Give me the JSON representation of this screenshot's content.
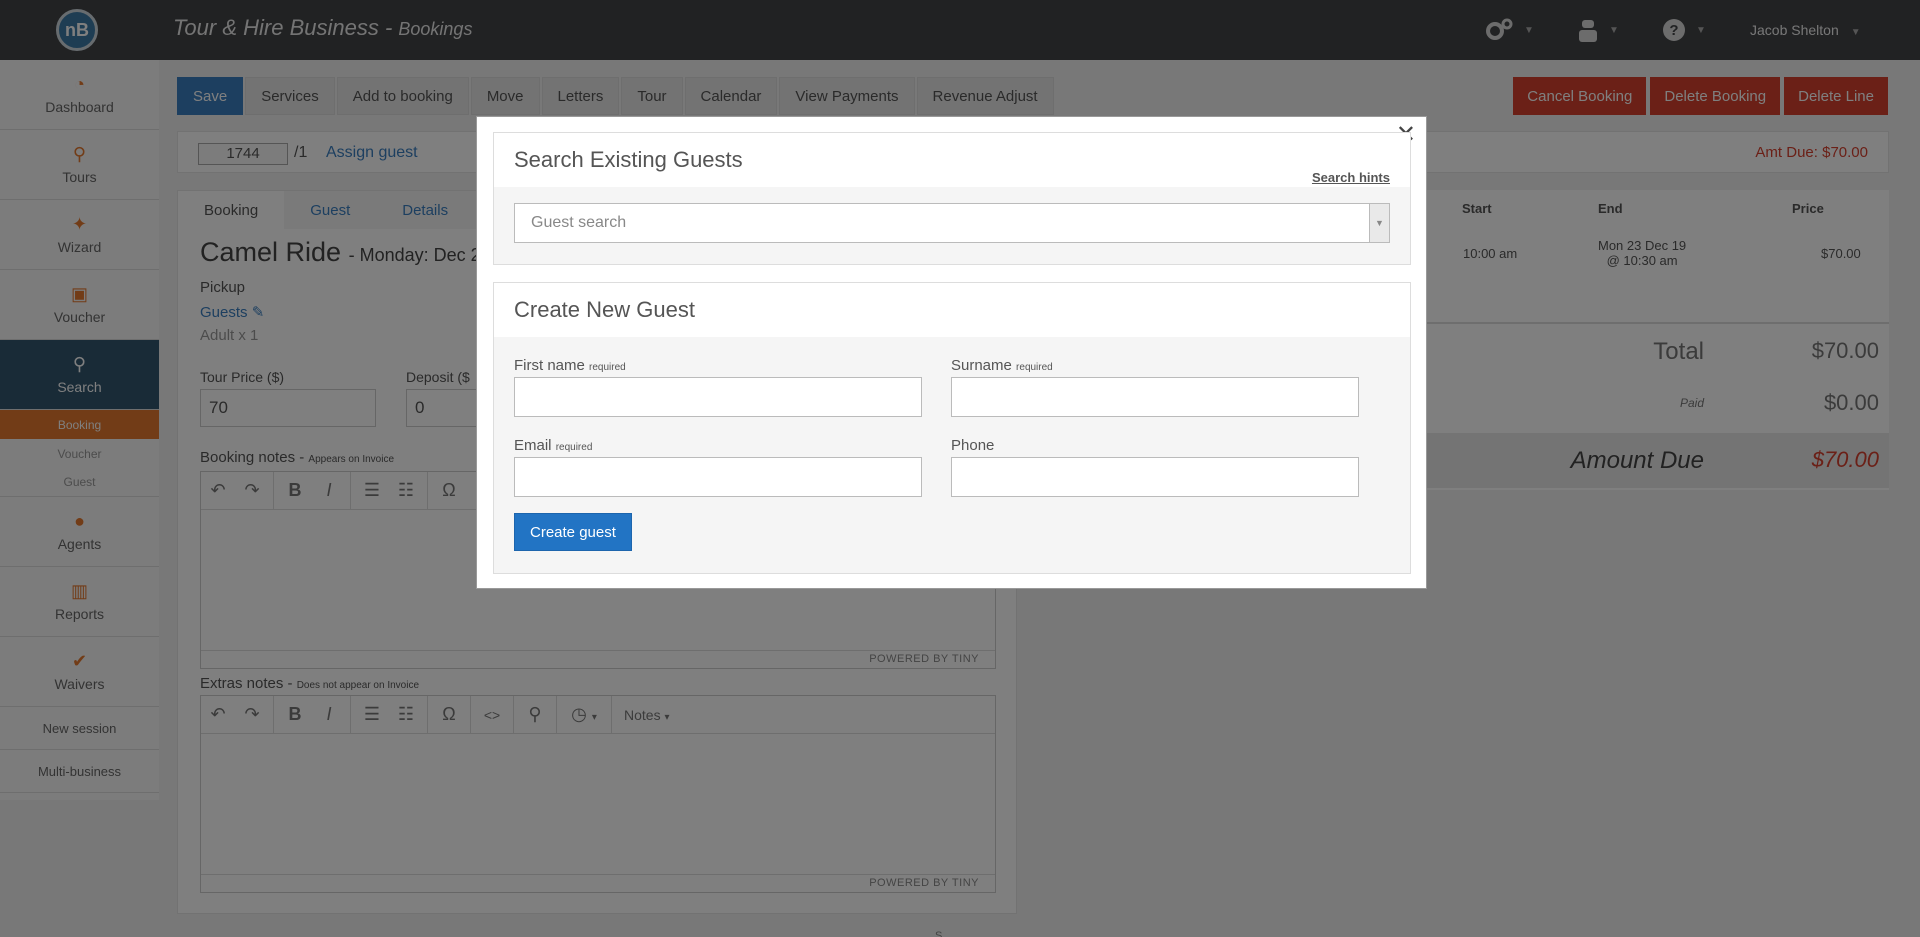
{
  "header": {
    "logo_text": "nB",
    "app_title": "Tour & Hire Business - ",
    "app_section": "Bookings",
    "user_name": "Jacob Shelton",
    "icons": [
      "gears-icon",
      "agent-icon",
      "help-icon"
    ]
  },
  "sidebar": {
    "items": [
      {
        "label": "Dashboard",
        "icon": "dashboard-icon"
      },
      {
        "label": "Tours",
        "icon": "tours-icon"
      },
      {
        "label": "Wizard",
        "icon": "wizard-icon"
      },
      {
        "label": "Voucher",
        "icon": "gift-icon"
      },
      {
        "label": "Search",
        "icon": "search-icon"
      }
    ],
    "search_sub": [
      "Booking",
      "Voucher",
      "Guest"
    ],
    "items2": [
      {
        "label": "Agents",
        "icon": "agent-icon"
      },
      {
        "label": "Reports",
        "icon": "chart-icon"
      },
      {
        "label": "Waivers",
        "icon": "check-icon"
      }
    ],
    "links": [
      "New session",
      "Multi-business"
    ]
  },
  "toolbar": {
    "save": "Save",
    "buttons": [
      "Services",
      "Add to booking",
      "Move",
      "Letters",
      "Tour",
      "Calendar",
      "View Payments",
      "Revenue Adjust"
    ],
    "right": [
      "Cancel Booking",
      "Delete Booking",
      "Delete Line"
    ]
  },
  "booking": {
    "number": "1744",
    "suffix": "/1",
    "assign_guest": "Assign guest",
    "amt_due": "Amt Due: $70.00"
  },
  "panel": {
    "tabs": [
      "Booking",
      "Guest",
      "Details"
    ],
    "tour_name": "Camel Ride",
    "tour_date": "- Monday: Dec 2",
    "pickup": "Pickup",
    "guests": "Guests",
    "guest_count": "Adult x 1",
    "tour_price_label": "Tour Price ($)",
    "tour_price": "70",
    "deposit_label": "Deposit ($",
    "deposit": "0",
    "booking_notes_label": "Booking notes - ",
    "booking_notes_hint": "Appears on Invoice",
    "extras_notes_label": "Extras notes - ",
    "extras_notes_hint": "Does not appear on Invoice",
    "powered_by": "POWERED BY TINY",
    "notes_menu": "Notes"
  },
  "summary": {
    "headers": [
      "Start",
      "End",
      "Price"
    ],
    "start": "10:00 am",
    "end_line1": "Mon 23 Dec 19",
    "end_line2": "@ 10:30 am",
    "price": "$70.00",
    "total_label": "Total",
    "total_value": "$70.00",
    "paid_label": "Paid",
    "paid_value": "$0.00",
    "due_label": "Amount Due",
    "due_value": "$70.00"
  },
  "modal": {
    "search_title": "Search Existing Guests",
    "search_hints": "Search hints",
    "search_placeholder": "Guest search",
    "create_title": "Create New Guest",
    "first_name": "First name",
    "surname": "Surname",
    "email": "Email",
    "phone": "Phone",
    "required": "required",
    "create_button": "Create guest"
  },
  "footer": {
    "text": "S"
  }
}
